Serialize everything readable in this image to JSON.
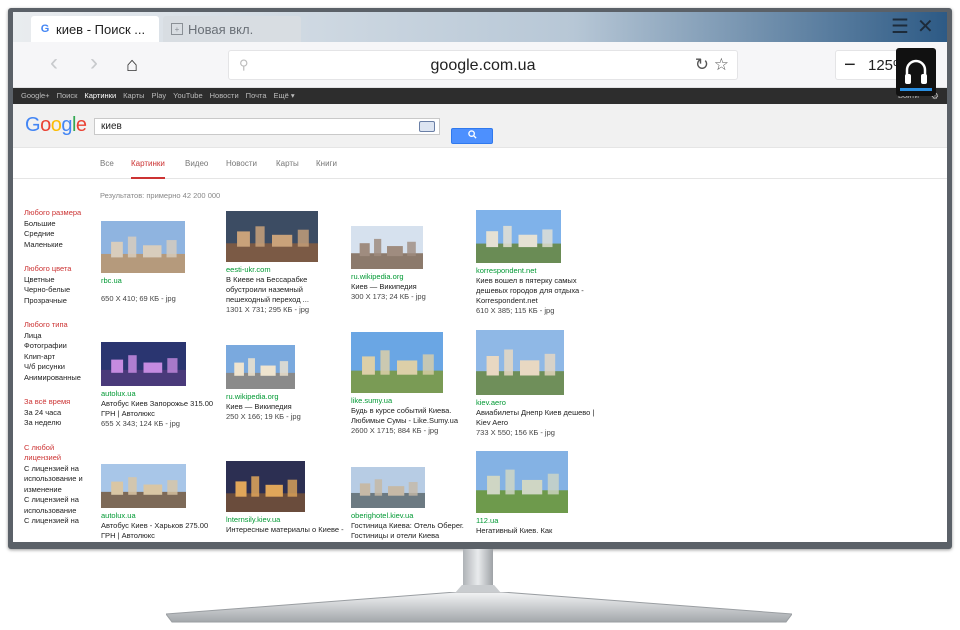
{
  "tabs": {
    "active": {
      "title": "киев - Поиск ..."
    },
    "inactive": {
      "title": "Новая вкл."
    }
  },
  "nav": {
    "url": "google.com.ua",
    "zoom": "125%"
  },
  "gbar": {
    "items": [
      "Google+",
      "Поиск",
      "Картинки",
      "Карты",
      "Play",
      "YouTube",
      "Новости",
      "Почта",
      "Ещё ▾"
    ],
    "signin": "Войти"
  },
  "search": {
    "logo": "Google",
    "query": "киев"
  },
  "search_tabs": [
    "Все",
    "Картинки",
    "Видео",
    "Новости",
    "Карты",
    "Книги"
  ],
  "results_count": "Результатов: примерно 42 200 000",
  "filters": [
    {
      "heading": "Любого размера",
      "items": [
        "Большие",
        "Средние",
        "Маленькие"
      ]
    },
    {
      "heading": "Любого цвета",
      "items": [
        "Цветные",
        "Черно-белые",
        "Прозрачные"
      ]
    },
    {
      "heading": "Любого типа",
      "items": [
        "Лица",
        "Фотографии",
        "Клип-арт",
        "Ч/б рисунки",
        "Анимированные"
      ]
    },
    {
      "heading": "За всё время",
      "items": [
        "За 24 часа",
        "За неделю"
      ]
    },
    {
      "heading": "С любой лицензией",
      "items": [
        "С лицензией на использование и изменение",
        "С лицензией на использование",
        "С лицензией на"
      ]
    }
  ],
  "results": [
    {
      "site": "rbc.ua",
      "desc": "",
      "meta": "650 X 410; 69 КБ - jpg"
    },
    {
      "site": "eesti-ukr.com",
      "desc": "В Киеве на Бессарабке обустроили наземный пешеходный переход ...",
      "meta": "1301 X 731; 295 КБ - jpg"
    },
    {
      "site": "ru.wikipedia.org",
      "desc": "Киев — Википедия",
      "meta": "300 X 173; 24 КБ - jpg"
    },
    {
      "site": "korrespondent.net",
      "desc": "Киев вошел в пятерку самых дешевых городов для отдыха - Korrespondent.net",
      "meta": "610 X 385; 115 КБ - jpg"
    },
    {
      "site": "autolux.ua",
      "desc": "Автобус Киев Запорожье 315.00 ГРН | Автолюкс",
      "meta": "655 X 343; 124 КБ - jpg"
    },
    {
      "site": "ru.wikipedia.org",
      "desc": "Киев — Википедия",
      "meta": "250 X 166; 19 КБ - jpg"
    },
    {
      "site": "like.sumy.ua",
      "desc": "Будь в курсе событий Киева. Любимые Сумы - Like.Sumy.ua",
      "meta": "2600 X 1715; 884 КБ - jpg"
    },
    {
      "site": "kiev.aero",
      "desc": "Авиабилеты Днепр Киев дешево | Kiev Aero",
      "meta": "733 X 550; 156 КБ - jpg"
    },
    {
      "site": "autolux.ua",
      "desc": "Автобус Киев - Харьков 275.00 ГРН | Автолюкс",
      "meta": ""
    },
    {
      "site": "lnternsily.kiev.ua",
      "desc": "Интересные материалы о Киеве -",
      "meta": ""
    },
    {
      "site": "oberighotel.kiev.ua",
      "desc": "Гостиница Киева: Отель Оберег. Гостиницы и отели Киева",
      "meta": ""
    },
    {
      "site": "112.ua",
      "desc": "Негативный Киев. Как",
      "meta": ""
    }
  ]
}
